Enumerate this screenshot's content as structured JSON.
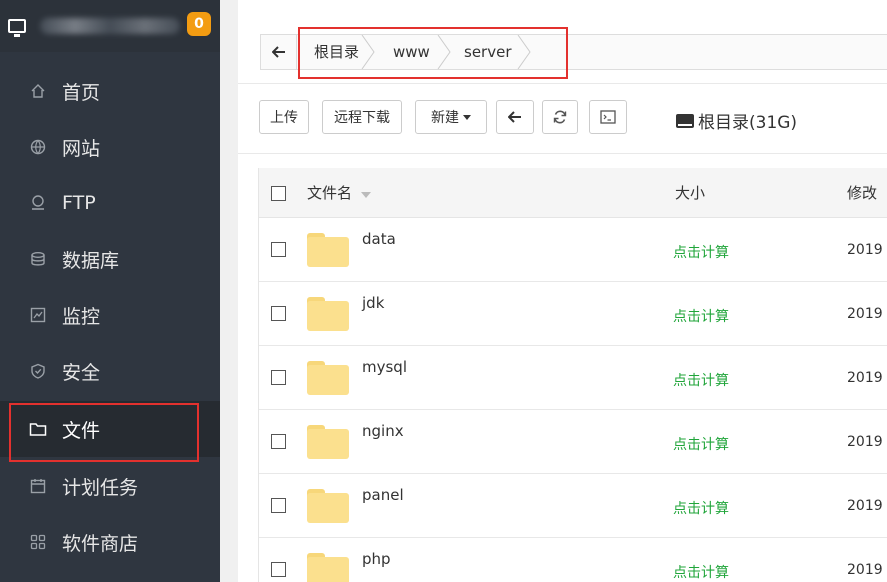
{
  "sidebar": {
    "badge": "0",
    "items": [
      {
        "label": "首页",
        "icon": "home-icon"
      },
      {
        "label": "网站",
        "icon": "globe-icon"
      },
      {
        "label": "FTP",
        "icon": "ftp-icon"
      },
      {
        "label": "数据库",
        "icon": "database-icon"
      },
      {
        "label": "监控",
        "icon": "monitor-chart-icon"
      },
      {
        "label": "安全",
        "icon": "shield-icon"
      },
      {
        "label": "文件",
        "icon": "folder-icon"
      },
      {
        "label": "计划任务",
        "icon": "calendar-icon"
      },
      {
        "label": "软件商店",
        "icon": "grid-icon"
      }
    ]
  },
  "breadcrumb": [
    "根目录",
    "www",
    "server"
  ],
  "toolbar": {
    "upload": "上传",
    "remote_download": "远程下载",
    "new": "新建",
    "disk_label": "根目录(31G)"
  },
  "table": {
    "headers": {
      "name": "文件名",
      "size": "大小",
      "mtime": "修改"
    },
    "rows": [
      {
        "name": "data",
        "size": "点击计算",
        "mtime": "2019"
      },
      {
        "name": "jdk",
        "size": "点击计算",
        "mtime": "2019"
      },
      {
        "name": "mysql",
        "size": "点击计算",
        "mtime": "2019"
      },
      {
        "name": "nginx",
        "size": "点击计算",
        "mtime": "2019"
      },
      {
        "name": "panel",
        "size": "点击计算",
        "mtime": "2019"
      },
      {
        "name": "php",
        "size": "点击计算",
        "mtime": "2019"
      }
    ]
  },
  "colors": {
    "sidebar_bg": "#2f3640",
    "accent_green": "#20a53a",
    "badge": "#f39c12",
    "highlight": "#e3312e"
  }
}
